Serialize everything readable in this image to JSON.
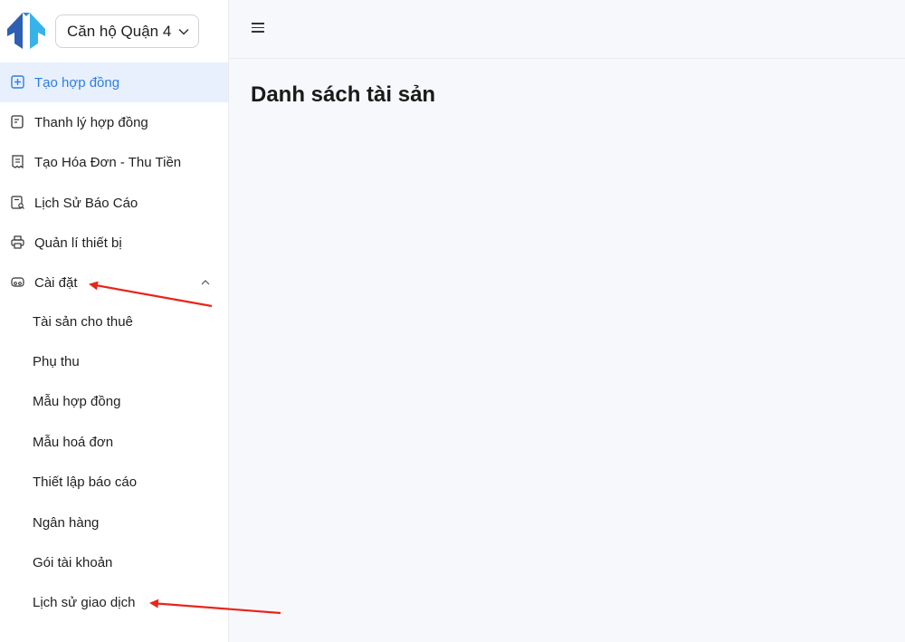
{
  "header": {
    "property_select_value": "Căn hộ Quận 4"
  },
  "sidebar": {
    "items": [
      {
        "label": "Tạo hợp đồng",
        "icon": "contract-add-icon",
        "active": true
      },
      {
        "label": "Thanh lý hợp đồng",
        "icon": "contract-icon"
      },
      {
        "label": "Tạo Hóa Đơn - Thu Tiền",
        "icon": "invoice-icon"
      },
      {
        "label": "Lịch Sử Báo Cáo",
        "icon": "report-search-icon"
      },
      {
        "label": "Quản lí thiết bị",
        "icon": "printer-icon"
      },
      {
        "label": "Cài đặt",
        "icon": "settings-icon",
        "expanded": true
      }
    ],
    "settings_subitems": [
      "Tài sản cho thuê",
      "Phụ thu",
      "Mẫu hợp đồng",
      "Mẫu hoá đơn",
      "Thiết lập báo cáo",
      "Ngân hàng",
      "Gói tài khoản",
      "Lịch sử giao dịch"
    ]
  },
  "topbar": {
    "menu_icon": "hamburger-icon"
  },
  "main": {
    "title": "Danh sách tài sản"
  },
  "colors": {
    "accent": "#2f7de1",
    "active_bg": "#e8f0fe",
    "annotation_arrow": "#e8251b",
    "logo_dark": "#2d5fb3",
    "logo_light": "#38b3e8"
  }
}
